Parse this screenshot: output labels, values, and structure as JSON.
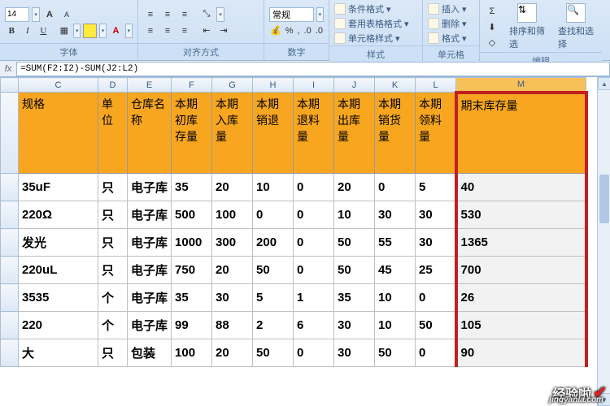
{
  "ribbon": {
    "font": {
      "label": "字体",
      "size": "14",
      "increase": "A",
      "decrease": "A"
    },
    "alignment": {
      "label": "对齐方式"
    },
    "number": {
      "label": "数字",
      "general": "常规",
      "percent": "%"
    },
    "styles": {
      "label": "样式",
      "cond_format": "条件格式",
      "table_format": "套用表格格式",
      "cell_styles": "单元格样式"
    },
    "cells": {
      "label": "单元格",
      "insert": "插入",
      "delete": "删除",
      "format": "格式"
    },
    "editing": {
      "label": "编辑",
      "sort": "排序和筛选",
      "find": "查找和选择"
    }
  },
  "formula_bar": {
    "fx": "fx",
    "formula": "=SUM(F2:I2)-SUM(J2:L2)"
  },
  "columns": {
    "stub": "",
    "C": "C",
    "D": "D",
    "E": "E",
    "F": "F",
    "G": "G",
    "H": "H",
    "I": "I",
    "J": "J",
    "K": "K",
    "L": "L",
    "M": "M"
  },
  "headers": {
    "C": "规格",
    "D": "单位",
    "E": "仓库名称",
    "F": "本期初库存量",
    "G": "本期入库量",
    "H": "本期销退",
    "I": "本期退料量",
    "J": "本期出库量",
    "K": "本期销货量",
    "L": "本期领料量",
    "M": "期末库存量"
  },
  "rows": [
    {
      "C": "35uF",
      "D": "只",
      "E": "电子库",
      "F": "35",
      "G": "20",
      "H": "10",
      "I": "0",
      "J": "20",
      "K": "0",
      "L": "5",
      "M": "40"
    },
    {
      "C": "220Ω",
      "D": "只",
      "E": "电子库",
      "F": "500",
      "G": "100",
      "H": "0",
      "I": "0",
      "J": "10",
      "K": "30",
      "L": "30",
      "M": "530"
    },
    {
      "C": "发光",
      "D": "只",
      "E": "电子库",
      "F": "1000",
      "G": "300",
      "H": "200",
      "I": "0",
      "J": "50",
      "K": "55",
      "L": "30",
      "M": "1365"
    },
    {
      "C": "220uL",
      "D": "只",
      "E": "电子库",
      "F": "750",
      "G": "20",
      "H": "50",
      "I": "0",
      "J": "50",
      "K": "45",
      "L": "25",
      "M": "700"
    },
    {
      "C": "3535",
      "D": "个",
      "E": "电子库",
      "F": "35",
      "G": "30",
      "H": "5",
      "I": "1",
      "J": "35",
      "K": "10",
      "L": "0",
      "M": "26"
    },
    {
      "C": "220",
      "D": "个",
      "E": "电子库",
      "F": "99",
      "G": "88",
      "H": "2",
      "I": "6",
      "J": "30",
      "K": "10",
      "L": "50",
      "M": "105"
    },
    {
      "C": "大",
      "D": "只",
      "E": "包装",
      "F": "100",
      "G": "20",
      "H": "50",
      "I": "0",
      "J": "30",
      "K": "50",
      "L": "0",
      "M": "90"
    }
  ],
  "watermark": {
    "text": "经验啦",
    "url": "jingyanla.com"
  }
}
